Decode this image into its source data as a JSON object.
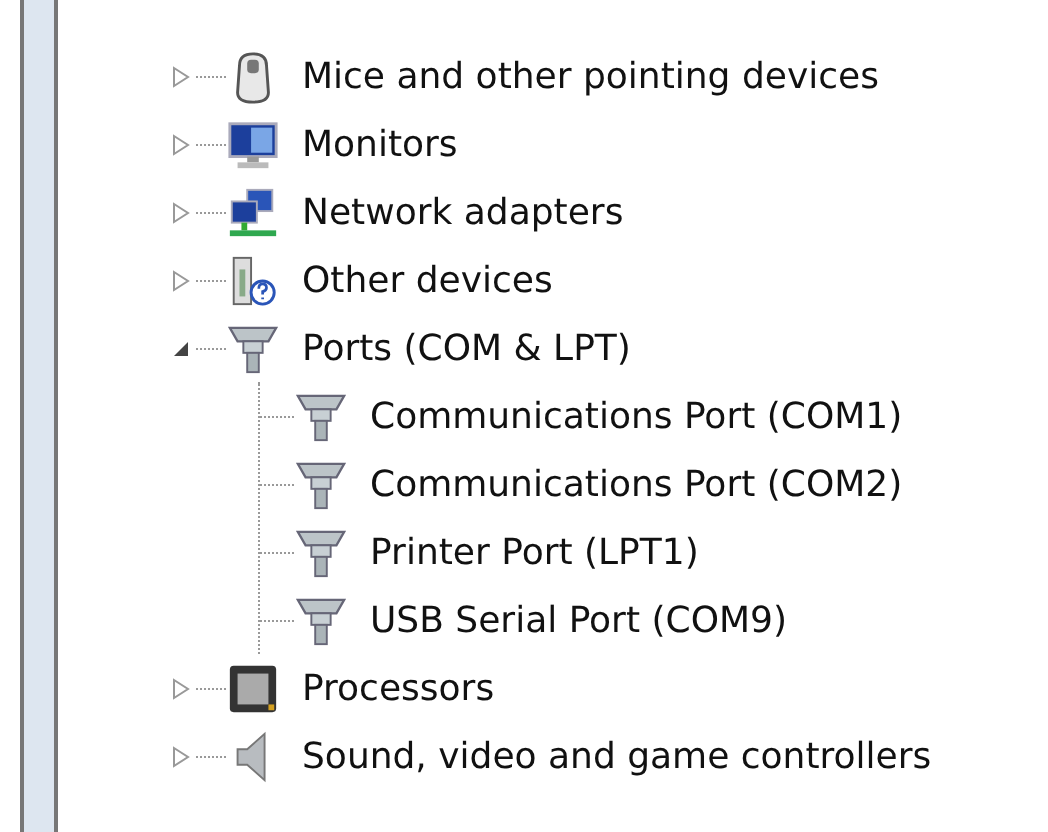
{
  "tree": {
    "items": [
      {
        "label": "Mice and other pointing devices",
        "kind": "mouse",
        "expanded": false
      },
      {
        "label": "Monitors",
        "kind": "monitor",
        "expanded": false
      },
      {
        "label": "Network adapters",
        "kind": "network",
        "expanded": false
      },
      {
        "label": "Other devices",
        "kind": "unknown",
        "expanded": false
      },
      {
        "label": "Ports (COM & LPT)",
        "kind": "port",
        "expanded": true,
        "children": [
          {
            "label": "Communications Port (COM1)",
            "kind": "port"
          },
          {
            "label": "Communications Port (COM2)",
            "kind": "port"
          },
          {
            "label": "Printer Port (LPT1)",
            "kind": "port"
          },
          {
            "label": "USB Serial Port (COM9)",
            "kind": "port"
          }
        ]
      },
      {
        "label": "Processors",
        "kind": "processor",
        "expanded": false
      },
      {
        "label": "Sound, video and game controllers",
        "kind": "speaker",
        "expanded": false
      }
    ]
  }
}
